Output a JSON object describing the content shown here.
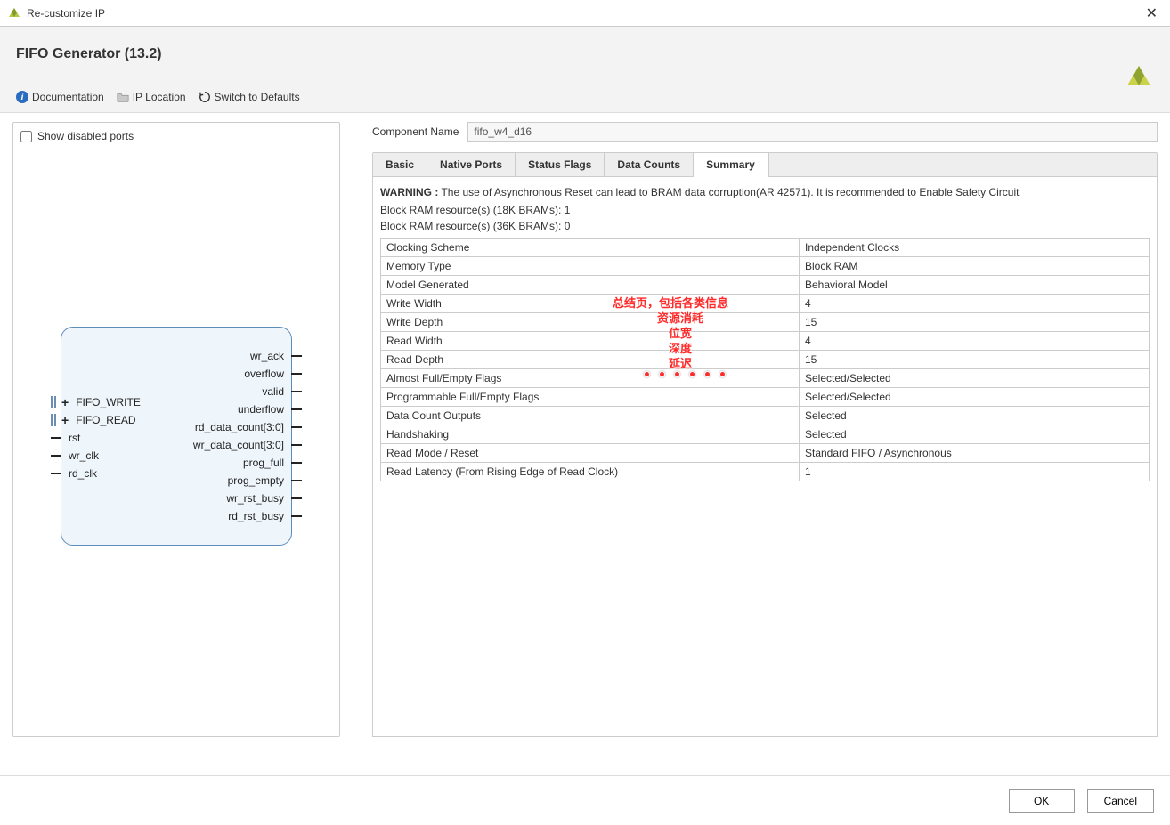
{
  "window": {
    "title": "Re-customize IP"
  },
  "header": {
    "ip_title": "FIFO Generator (13.2)",
    "toolbar": {
      "documentation": "Documentation",
      "ip_location": "IP Location",
      "switch_defaults": "Switch to Defaults"
    }
  },
  "left": {
    "show_disabled_label": "Show disabled ports",
    "bus_ports": [
      {
        "name": "FIFO_WRITE"
      },
      {
        "name": "FIFO_READ"
      }
    ],
    "left_ports": [
      "rst",
      "wr_clk",
      "rd_clk"
    ],
    "right_ports": [
      "wr_ack",
      "overflow",
      "valid",
      "underflow",
      "rd_data_count[3:0]",
      "wr_data_count[3:0]",
      "prog_full",
      "prog_empty",
      "wr_rst_busy",
      "rd_rst_busy"
    ]
  },
  "right": {
    "component_name_label": "Component Name",
    "component_name_value": "fifo_w4_d16",
    "tabs": [
      "Basic",
      "Native Ports",
      "Status Flags",
      "Data Counts",
      "Summary"
    ],
    "active_tab": "Summary",
    "warning_prefix": "WARNING :",
    "warning_text": " The use of Asynchronous Reset can lead to BRAM data corruption(AR 42571). It is recommended to Enable Safety Circuit",
    "bram_18k": "Block RAM resource(s) (18K BRAMs): 1",
    "bram_36k": "Block RAM resource(s) (36K BRAMs): 0",
    "summary_rows": [
      {
        "k": "Clocking Scheme",
        "v": "Independent Clocks"
      },
      {
        "k": "Memory Type",
        "v": "Block RAM"
      },
      {
        "k": "Model Generated",
        "v": "Behavioral Model"
      },
      {
        "k": "Write Width",
        "v": "4"
      },
      {
        "k": "Write Depth",
        "v": "15"
      },
      {
        "k": "Read Width",
        "v": "4"
      },
      {
        "k": "Read Depth",
        "v": "15"
      },
      {
        "k": "Almost Full/Empty Flags",
        "v": "Selected/Selected"
      },
      {
        "k": "Programmable Full/Empty Flags",
        "v": "Selected/Selected"
      },
      {
        "k": "Data Count Outputs",
        "v": "Selected"
      },
      {
        "k": "Handshaking",
        "v": "Selected"
      },
      {
        "k": "Read Mode / Reset",
        "v": "Standard FIFO / Asynchronous"
      },
      {
        "k": "Read Latency (From Rising Edge of Read Clock)",
        "v": "1"
      }
    ]
  },
  "annotations": {
    "l1": "总结页，包括各类信息",
    "l2": "资源消耗",
    "l3": "位宽",
    "l4": "深度",
    "l5": "延迟"
  },
  "footer": {
    "ok": "OK",
    "cancel": "Cancel"
  }
}
